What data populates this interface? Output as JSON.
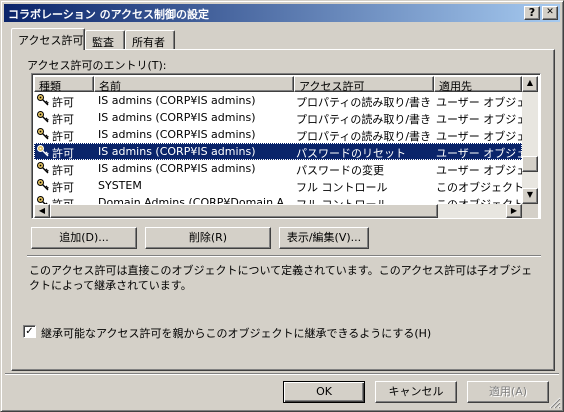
{
  "window": {
    "title": "コラボレーション のアクセス制御の設定"
  },
  "titlebar_buttons": {
    "help": "?",
    "close": "✕"
  },
  "tabs": [
    {
      "label": "アクセス許可",
      "active": true
    },
    {
      "label": "監査",
      "active": false
    },
    {
      "label": "所有者",
      "active": false
    }
  ],
  "entries_label": "アクセス許可のエントリ(T):",
  "columns": [
    "種類",
    "名前",
    "アクセス許可",
    "適用先"
  ],
  "rows": [
    {
      "type": "許可",
      "name": "IS admins (CORP¥IS admins)",
      "permission": "プロパティの読み取り/書き...",
      "applies_to": "ユーザー オブジェクト"
    },
    {
      "type": "許可",
      "name": "IS admins (CORP¥IS admins)",
      "permission": "プロパティの読み取り/書き...",
      "applies_to": "ユーザー オブジェクト"
    },
    {
      "type": "許可",
      "name": "IS admins (CORP¥IS admins)",
      "permission": "プロパティの読み取り/書き...",
      "applies_to": "ユーザー オブジェクト"
    },
    {
      "type": "許可",
      "name": "IS admins (CORP¥IS admins)",
      "permission": "パスワードのリセット",
      "applies_to": "ユーザー オブジェクト"
    },
    {
      "type": "許可",
      "name": "IS admins (CORP¥IS admins)",
      "permission": "パスワードの変更",
      "applies_to": "ユーザー オブジェクト"
    },
    {
      "type": "許可",
      "name": "SYSTEM",
      "permission": "フル コントロール",
      "applies_to": "このオブジェクトのみ"
    },
    {
      "type": "許可",
      "name": "Domain Admins (CORP¥Domain A...",
      "permission": "フル コントロール",
      "applies_to": "このオブジェクトのみ"
    }
  ],
  "selected_row": 3,
  "buttons": {
    "add": "追加(D)...",
    "remove": "削除(R)",
    "view_edit": "表示/編集(V)..."
  },
  "description": "このアクセス許可は直接このオブジェクトについて定義されています。このアクセス許可は子オブジェクトによって継承されています。",
  "inherit_checkbox": {
    "label": "継承可能なアクセス許可を親からこのオブジェクトに継承できるようにする(H)",
    "checked": true,
    "mark": "✓"
  },
  "footer": {
    "ok": "OK",
    "cancel": "キャンセル",
    "apply": "適用(A)"
  },
  "scroll_arrows": {
    "up": "▲",
    "down": "▼",
    "left": "◀",
    "right": "▶"
  },
  "colors": {
    "title_start": "#0a246a",
    "title_end": "#a6caf0",
    "selection": "#0a246a",
    "face": "#d4d0c8"
  },
  "icons": {
    "row": "key-icon"
  }
}
